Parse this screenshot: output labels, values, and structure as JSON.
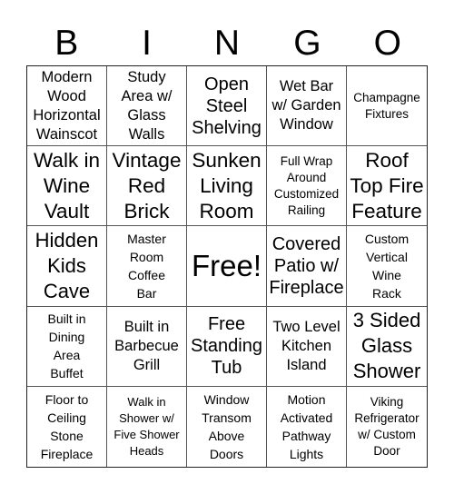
{
  "header": [
    "B",
    "I",
    "N",
    "G",
    "O"
  ],
  "cells": [
    {
      "text": "Modern\nWood\nHorizontal\nWainscot",
      "size": "s16"
    },
    {
      "text": "Study\nArea w/\nGlass\nWalls",
      "size": "s16"
    },
    {
      "text": "Open\nSteel\nShelving",
      "size": "s20"
    },
    {
      "text": "Wet Bar\nw/ Garden\nWindow",
      "size": "s16"
    },
    {
      "text": "Champagne\nFixtures",
      "size": "s13"
    },
    {
      "text": "Walk in\nWine\nVault",
      "size": "s23"
    },
    {
      "text": "Vintage\nRed\nBrick",
      "size": "s23"
    },
    {
      "text": "Sunken\nLiving\nRoom",
      "size": "s23"
    },
    {
      "text": "Full Wrap\nAround\nCustomized\nRailing",
      "size": "s13"
    },
    {
      "text": "Roof\nTop Fire\nFeature",
      "size": "s23"
    },
    {
      "text": "Hidden\nKids\nCave",
      "size": "s22"
    },
    {
      "text": "Master\nRoom\nCoffee\nBar",
      "size": "s14"
    },
    {
      "text": "Free!",
      "size": "s32"
    },
    {
      "text": "Covered\nPatio w/\nFireplace",
      "size": "s20"
    },
    {
      "text": "Custom\nVertical\nWine\nRack",
      "size": "s14"
    },
    {
      "text": "Built in\nDining\nArea\nBuffet",
      "size": "s14"
    },
    {
      "text": "Built in\nBarbecue\nGrill",
      "size": "s16"
    },
    {
      "text": "Free\nStanding\nTub",
      "size": "s20"
    },
    {
      "text": "Two Level\nKitchen\nIsland",
      "size": "s16"
    },
    {
      "text": "3 Sided\nGlass\nShower",
      "size": "s22"
    },
    {
      "text": "Floor to\nCeiling\nStone\nFireplace",
      "size": "s14"
    },
    {
      "text": "Walk in\nShower w/\nFive Shower\nHeads",
      "size": "s12"
    },
    {
      "text": "Window\nTransom\nAbove\nDoors",
      "size": "s14"
    },
    {
      "text": "Motion\nActivated\nPathway\nLights",
      "size": "s14"
    },
    {
      "text": "Viking\nRefrigerator\nw/ Custom\nDoor",
      "size": "s13"
    }
  ]
}
